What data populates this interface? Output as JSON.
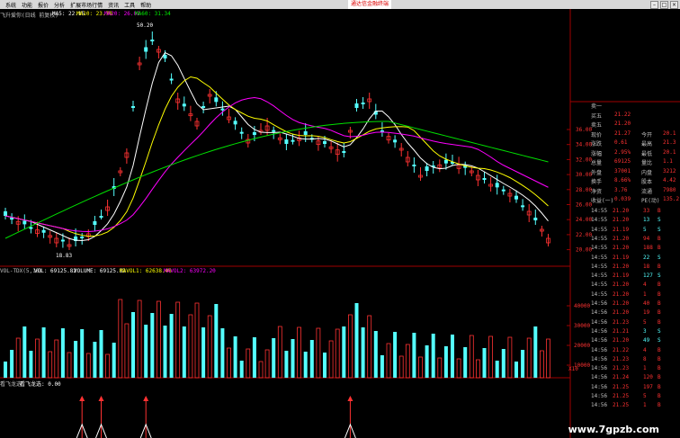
{
  "menubar": {
    "items": [
      "系统",
      "功能",
      "报价",
      "分析",
      "扩展市场行情",
      "资讯",
      "工具",
      "帮助"
    ],
    "promo": "通达信金融终端"
  },
  "main_legend": {
    "title": "飞升爱你(日线 前复权)",
    "ma5": "MA5: 22.15",
    "ma10": "MA10: 23.70",
    "ma20": "MA20: 26.02",
    "ma60": "MA60: 31.34",
    "high_marker": "50.20",
    "low_marker": "18.83"
  },
  "price_axis": [
    "36.00",
    "34.00",
    "32.00",
    "30.00",
    "28.00",
    "26.00",
    "24.00",
    "22.00",
    "20.00"
  ],
  "vol_legend": {
    "title": "VOL-TDX(5,10)",
    "vol": "VOL: 69125.82",
    "volume": "VOLUME: 69125.82",
    "mavol1": "MAVOL1: 62638.40",
    "mavol2": "MAVOL2: 63972.20"
  },
  "vol_axis": [
    "40000",
    "30000",
    "20000",
    "10000"
  ],
  "vol_unit": "X10",
  "ind_legend": {
    "title": "看飞龙选",
    "value": "看飞龙选: 0.00"
  },
  "quote_panel": {
    "rows": [
      {
        "label": "卖一",
        "value": "",
        "extra": ""
      },
      {
        "label": "买五",
        "value": "21.22",
        "extra": ""
      },
      {
        "label": "卖五",
        "value": "21.20",
        "extra": ""
      },
      {
        "label": "现价",
        "value": "21.27",
        "label2": "今开",
        "value2": "20.1"
      },
      {
        "label": "涨跌",
        "value": "0.61",
        "label2": "最高",
        "value2": "21.3"
      },
      {
        "label": "涨幅",
        "value": "2.95%",
        "label2": "最低",
        "value2": "20.1"
      },
      {
        "label": "总量",
        "value": "69125",
        "label2": "量比",
        "value2": "1.1"
      },
      {
        "label": "外盘",
        "value": "37001",
        "label2": "内盘",
        "value2": "3212"
      },
      {
        "label": "换手",
        "value": "8.66%",
        "label2": "股本",
        "value2": "4.42"
      },
      {
        "label": "净资",
        "value": "3.76",
        "label2": "流通",
        "value2": "7980"
      },
      {
        "label": "收益(一)",
        "value": "0.039",
        "label2": "PE(动)",
        "value2": "135.2"
      }
    ]
  },
  "ticks": [
    {
      "t": "14:55",
      "p": "21.20",
      "v": "33",
      "s": "B"
    },
    {
      "t": "14:55",
      "p": "21.20",
      "v": "13",
      "s": "S"
    },
    {
      "t": "14:55",
      "p": "21.19",
      "v": "5",
      "s": "S"
    },
    {
      "t": "14:55",
      "p": "21.20",
      "v": "94",
      "s": "B"
    },
    {
      "t": "14:55",
      "p": "21.20",
      "v": "188",
      "s": "B"
    },
    {
      "t": "14:55",
      "p": "21.19",
      "v": "22",
      "s": "S"
    },
    {
      "t": "14:55",
      "p": "21.20",
      "v": "18",
      "s": "B"
    },
    {
      "t": "14:55",
      "p": "21.19",
      "v": "127",
      "s": "S"
    },
    {
      "t": "14:55",
      "p": "21.20",
      "v": "4",
      "s": "B"
    },
    {
      "t": "14:55",
      "p": "21.20",
      "v": "1",
      "s": "B"
    },
    {
      "t": "14:56",
      "p": "21.20",
      "v": "40",
      "s": "B"
    },
    {
      "t": "14:56",
      "p": "21.20",
      "v": "19",
      "s": "B"
    },
    {
      "t": "14:56",
      "p": "21.23",
      "v": "5",
      "s": "B"
    },
    {
      "t": "14:56",
      "p": "21.21",
      "v": "3",
      "s": "S"
    },
    {
      "t": "14:56",
      "p": "21.20",
      "v": "49",
      "s": "S"
    },
    {
      "t": "14:56",
      "p": "21.22",
      "v": "4",
      "s": "B"
    },
    {
      "t": "14:56",
      "p": "21.23",
      "v": "8",
      "s": "B"
    },
    {
      "t": "14:56",
      "p": "21.23",
      "v": "1",
      "s": "B"
    },
    {
      "t": "14:56",
      "p": "21.24",
      "v": "120",
      "s": "B"
    },
    {
      "t": "14:56",
      "p": "21.25",
      "v": "197",
      "s": "B"
    },
    {
      "t": "14:56",
      "p": "21.25",
      "v": "5",
      "s": "B"
    },
    {
      "t": "14:56",
      "p": "21.25",
      "v": "1",
      "s": "B"
    }
  ],
  "watermark": "www.7gpzb.com",
  "colors": {
    "up": "#ff3232",
    "down": "#54ffff",
    "ma5": "#ffffff",
    "ma10": "#ffff00",
    "ma20": "#ff00ff",
    "ma60": "#00e000",
    "grid": "#a00000"
  }
}
